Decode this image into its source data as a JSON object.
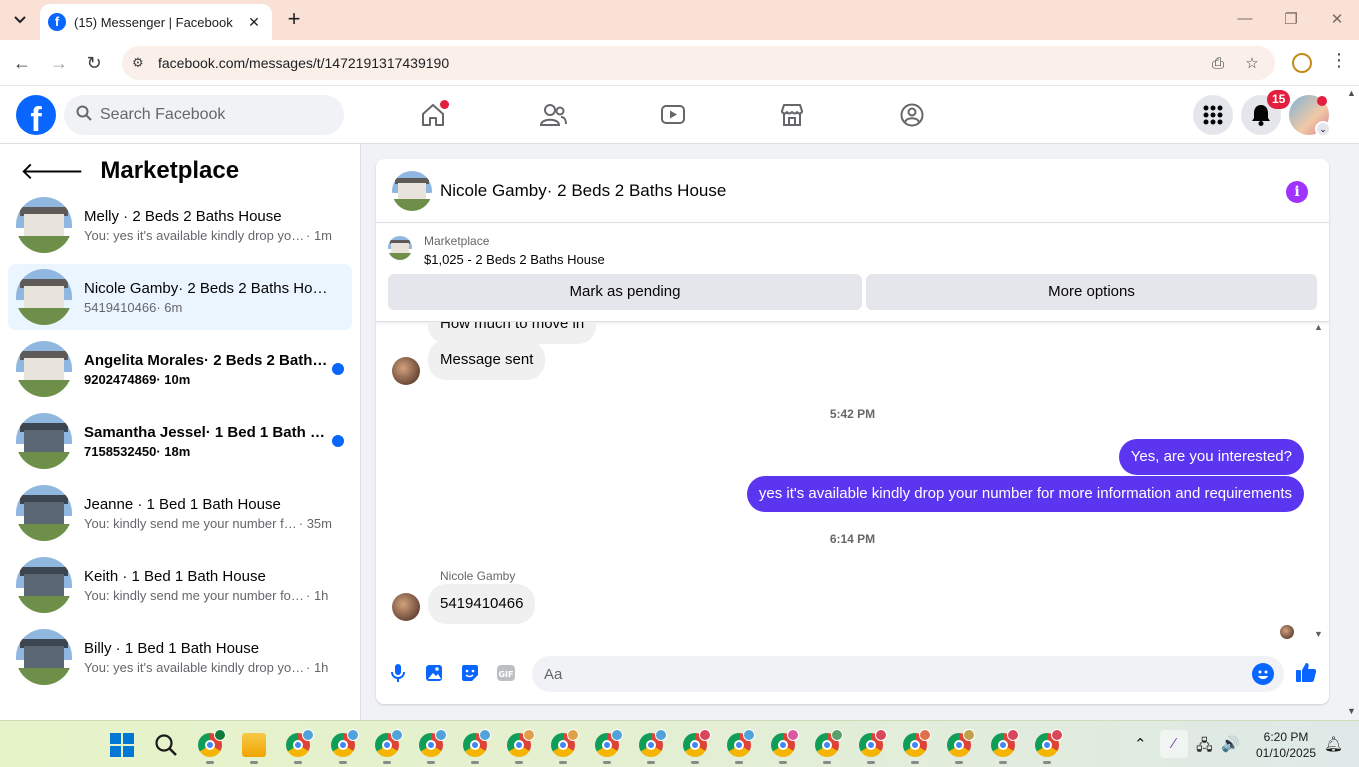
{
  "browser": {
    "tab_title": "(15) Messenger | Facebook",
    "url": "facebook.com/messages/t/1472191317439190"
  },
  "header": {
    "search_placeholder": "Search Facebook",
    "notification_count": "15",
    "accent": "#0866ff"
  },
  "sidebar": {
    "title": "Marketplace",
    "conversations": [
      {
        "name": "Melly · 2 Beds 2 Baths House",
        "preview": "You: yes it's available kindly drop you...",
        "time": " · 1m",
        "unread": false,
        "active": false,
        "dark_house": false
      },
      {
        "name": "Nicole Gamby· 2 Beds 2 Baths House",
        "preview": "5419410466",
        "time": " · 6m",
        "unread": false,
        "active": true,
        "dark_house": false
      },
      {
        "name": "Angelita Morales· 2 Beds 2 Baths House",
        "preview": "9202474869",
        "time": " · 10m",
        "unread": true,
        "active": false,
        "dark_house": false
      },
      {
        "name": "Samantha Jessel· 1 Bed 1 Bath House",
        "preview": "7158532450",
        "time": " · 18m",
        "unread": true,
        "active": false,
        "dark_house": true
      },
      {
        "name": "Jeanne · 1 Bed 1 Bath House",
        "preview": "You: kindly send me your number fo...",
        "time": " · 35m",
        "unread": false,
        "active": false,
        "dark_house": true
      },
      {
        "name": "Keith · 1 Bed 1 Bath House",
        "preview": "You: kindly send me your number for ...",
        "time": " · 1h",
        "unread": false,
        "active": false,
        "dark_house": true
      },
      {
        "name": "Billy · 1 Bed 1 Bath House",
        "preview": "You: yes it's available kindly drop your...",
        "time": " · 1h",
        "unread": false,
        "active": false,
        "dark_house": true
      }
    ]
  },
  "chat": {
    "title": "Nicole Gamby· 2 Beds 2 Baths House",
    "marketplace_label": "Marketplace",
    "listing": "$1,025 - 2 Beds 2 Baths House",
    "mark_pending_label": "Mark as pending",
    "more_options_label": "More options",
    "messages": {
      "in_partial": "How much to move in",
      "in_sent": "Message sent",
      "time1": "5:42 PM",
      "out1": "Yes, are you interested?",
      "out2": "yes it's available kindly drop your number for more information and requirements",
      "time2": "6:14 PM",
      "sender": "Nicole Gamby",
      "in_number": "5419410466"
    },
    "composer_placeholder": "Aa",
    "outgoing_color": "#5b35f0"
  },
  "taskbar": {
    "time": "6:20 PM",
    "date": "01/10/2025"
  }
}
